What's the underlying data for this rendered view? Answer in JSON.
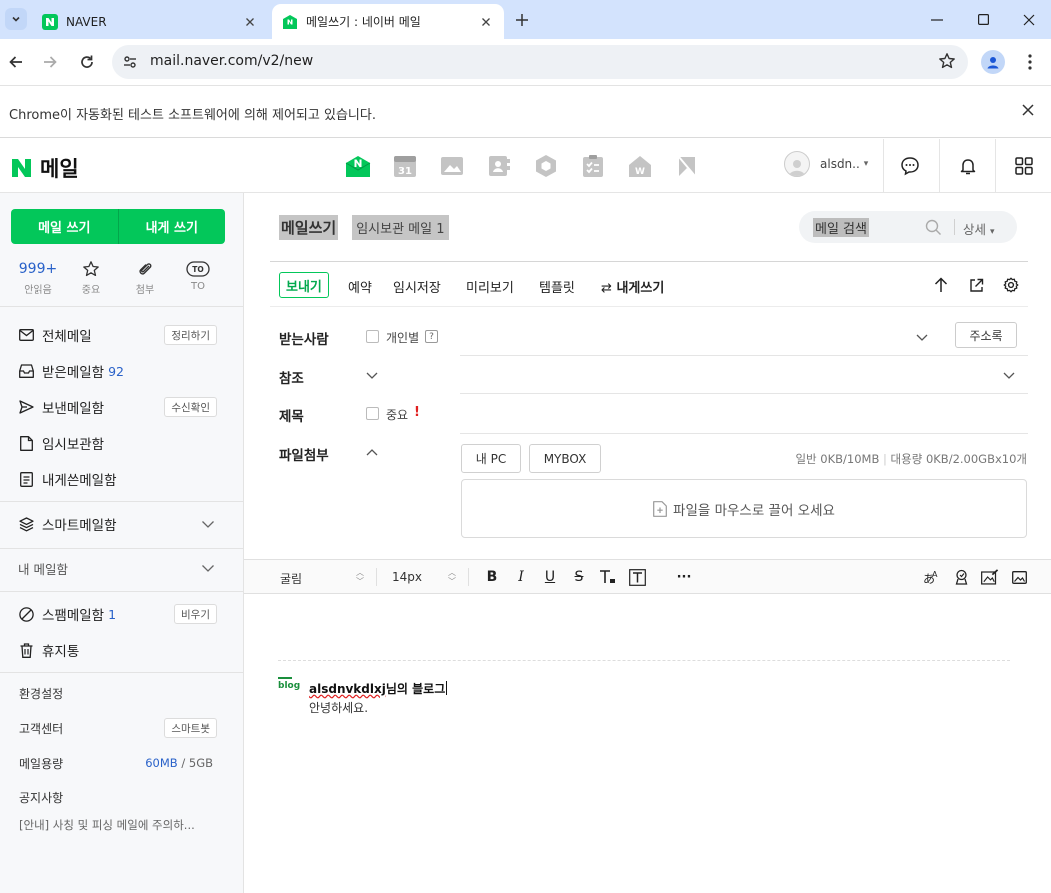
{
  "browser": {
    "tabs": [
      {
        "title": "NAVER",
        "active": false
      },
      {
        "title": "메일쓰기 : 네이버 메일",
        "active": true
      }
    ],
    "url": "mail.naver.com/v2/new",
    "infobar": "Chrome이 자동화된 테스트 소프트웨어에 의해 제어되고 있습니다."
  },
  "header": {
    "logo_text": "메일",
    "account_name": "alsdn..",
    "calendar_day": "31"
  },
  "sidebar": {
    "write_button": "메일 쓰기",
    "self_write_button": "내게 쓰기",
    "quick": [
      {
        "top": "999+",
        "label": "안읽음"
      },
      {
        "label": "중요"
      },
      {
        "label": "첨부"
      },
      {
        "top": "TO",
        "label": "TO"
      }
    ],
    "mailboxes": {
      "all": {
        "label": "전체메일",
        "action": "정리하기"
      },
      "inbox": {
        "label": "받은메일함",
        "count": "92"
      },
      "sent": {
        "label": "보낸메일함",
        "action": "수신확인"
      },
      "drafts": {
        "label": "임시보관함"
      },
      "self": {
        "label": "내게쓴메일함"
      },
      "smart": {
        "label": "스마트메일함"
      },
      "my": {
        "label": "내 메일함"
      },
      "spam": {
        "label": "스팸메일함",
        "count": "1",
        "action": "비우기"
      },
      "trash": {
        "label": "휴지통"
      }
    },
    "footer": {
      "settings": "환경설정",
      "support": "고객센터",
      "support_action": "스마트봇",
      "capacity_label": "메일용량",
      "capacity_used": "60MB",
      "capacity_sep": "/",
      "capacity_total": "5GB",
      "notice": "공지사항",
      "notice_item": "[안내] 사칭 및 피싱 메일에 주의하..."
    }
  },
  "compose": {
    "breadcrumb_title": "메일쓰기",
    "breadcrumb_drafts": "임시보관 메일 1",
    "search_placeholder": "메일 검색",
    "search_detail": "상세",
    "actions": {
      "send": "보내기",
      "schedule": "예약",
      "save": "임시저장",
      "preview": "미리보기",
      "template": "템플릿",
      "to_self": "내게쓰기"
    },
    "fields": {
      "to": "받는사람",
      "individual": "개인별",
      "help": "?",
      "address_book": "주소록",
      "cc": "참조",
      "subject": "제목",
      "important": "중요",
      "important_mark": "!",
      "attach": "파일첨부",
      "my_pc": "내 PC",
      "mybox": "MYBOX",
      "capacity_normal": "일반 0KB/10MB",
      "capacity_large": "대용량 0KB/2.00GBx10개",
      "dropzone": "파일을 마우스로 끌어 오세요"
    },
    "editor": {
      "font": "굴림",
      "size": "14px",
      "more": "···",
      "sig_badge": "blog",
      "sig_user": "alsdnvkdlxj",
      "sig_suffix": "님의 블로그",
      "sig_body": "안녕하세요."
    }
  },
  "colors": {
    "naver_green": "#03c75a",
    "link_blue": "#2a62c9",
    "tab_strip": "#d3e3fd"
  }
}
